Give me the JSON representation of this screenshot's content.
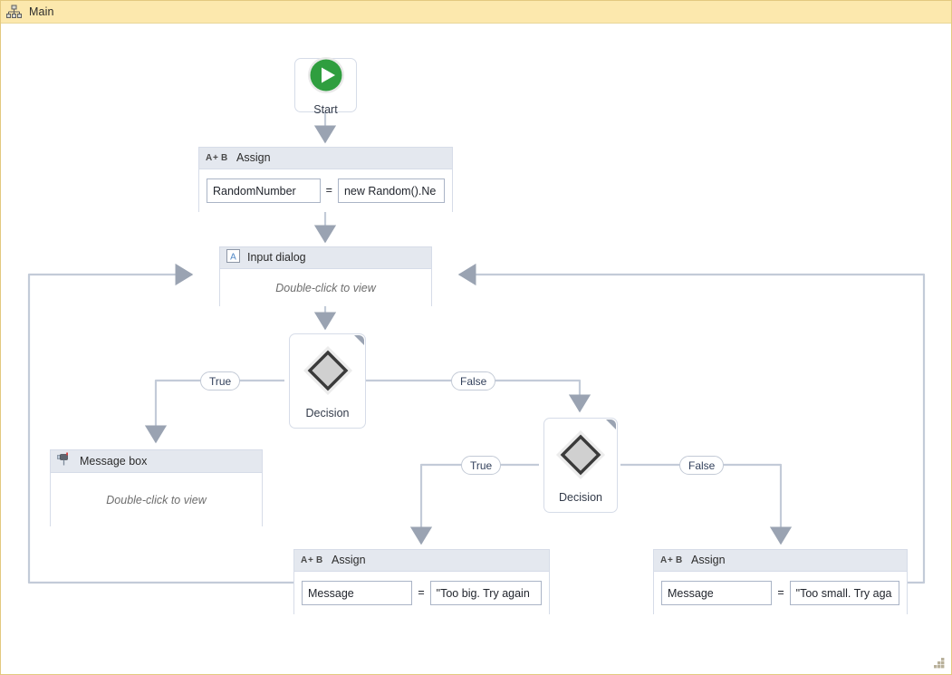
{
  "window": {
    "title": "Main",
    "title_icon": "hierarchy-icon",
    "titlebar_bg": "#fce8ad",
    "canvas_bg": "#ffffff",
    "resize_grip_icon": "resize-grip-icon"
  },
  "palette": {
    "node_border": "#d6dce8",
    "header_bg": "#e4e8ef",
    "wire": "#c3cbd8",
    "arrow": "#9aa3b2",
    "start_green": "#2f9e3f",
    "diamond_fill": "#d0d0d0",
    "diamond_stroke": "#3a3a3a",
    "field_border": "#aab4c6",
    "hint_text": "#6d6d6d"
  },
  "nodes": {
    "start": {
      "label": "Start",
      "icon": "play-circle-icon"
    },
    "assign_random": {
      "title": "Assign",
      "icon": "assign-icon",
      "left_value": "RandomNumber",
      "operator": "=",
      "right_value": "new Random().Ne"
    },
    "input_dialog": {
      "title": "Input dialog",
      "icon": "input-dialog-icon",
      "hint": "Double-click to view"
    },
    "decision_1": {
      "label": "Decision",
      "icon": "diamond-icon"
    },
    "decision_2": {
      "label": "Decision",
      "icon": "diamond-icon"
    },
    "message_box": {
      "title": "Message box",
      "icon": "mailbox-icon",
      "hint": "Double-click to view"
    },
    "assign_too_big": {
      "title": "Assign",
      "icon": "assign-icon",
      "left_value": "Message",
      "operator": "=",
      "right_value": "\"Too big. Try again"
    },
    "assign_too_small": {
      "title": "Assign",
      "icon": "assign-icon",
      "left_value": "Message",
      "operator": "=",
      "right_value": "\"Too small. Try aga"
    }
  },
  "branch_labels": {
    "d1_true": "True",
    "d1_false": "False",
    "d2_true": "True",
    "d2_false": "False"
  }
}
